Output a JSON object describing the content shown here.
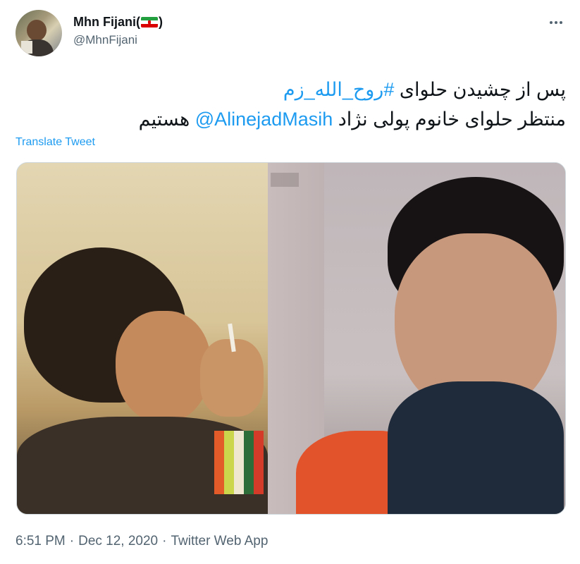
{
  "author": {
    "display_name": "Mhn Fijani(",
    "display_name_suffix": ")",
    "flag_icon": "iran-flag-emoji",
    "handle": "@MhnFijani"
  },
  "tweet": {
    "text_line1_prefix": "پس از چشیدن حلوای",
    "hashtag": "#روح_الله_زم",
    "text_line2_prefix": "منتظر حلوای خانوم پولی نژاد",
    "mention": "@AlinejadMasih",
    "text_line2_suffix": "هستیم",
    "translate_label": "Translate Tweet"
  },
  "meta": {
    "time": "6:51 PM",
    "date": "Dec 12, 2020",
    "source": "Twitter Web App",
    "separator": "·"
  },
  "colors": {
    "link": "#1d9bf0",
    "secondary_text": "#536471",
    "primary_text": "#0f1419"
  }
}
